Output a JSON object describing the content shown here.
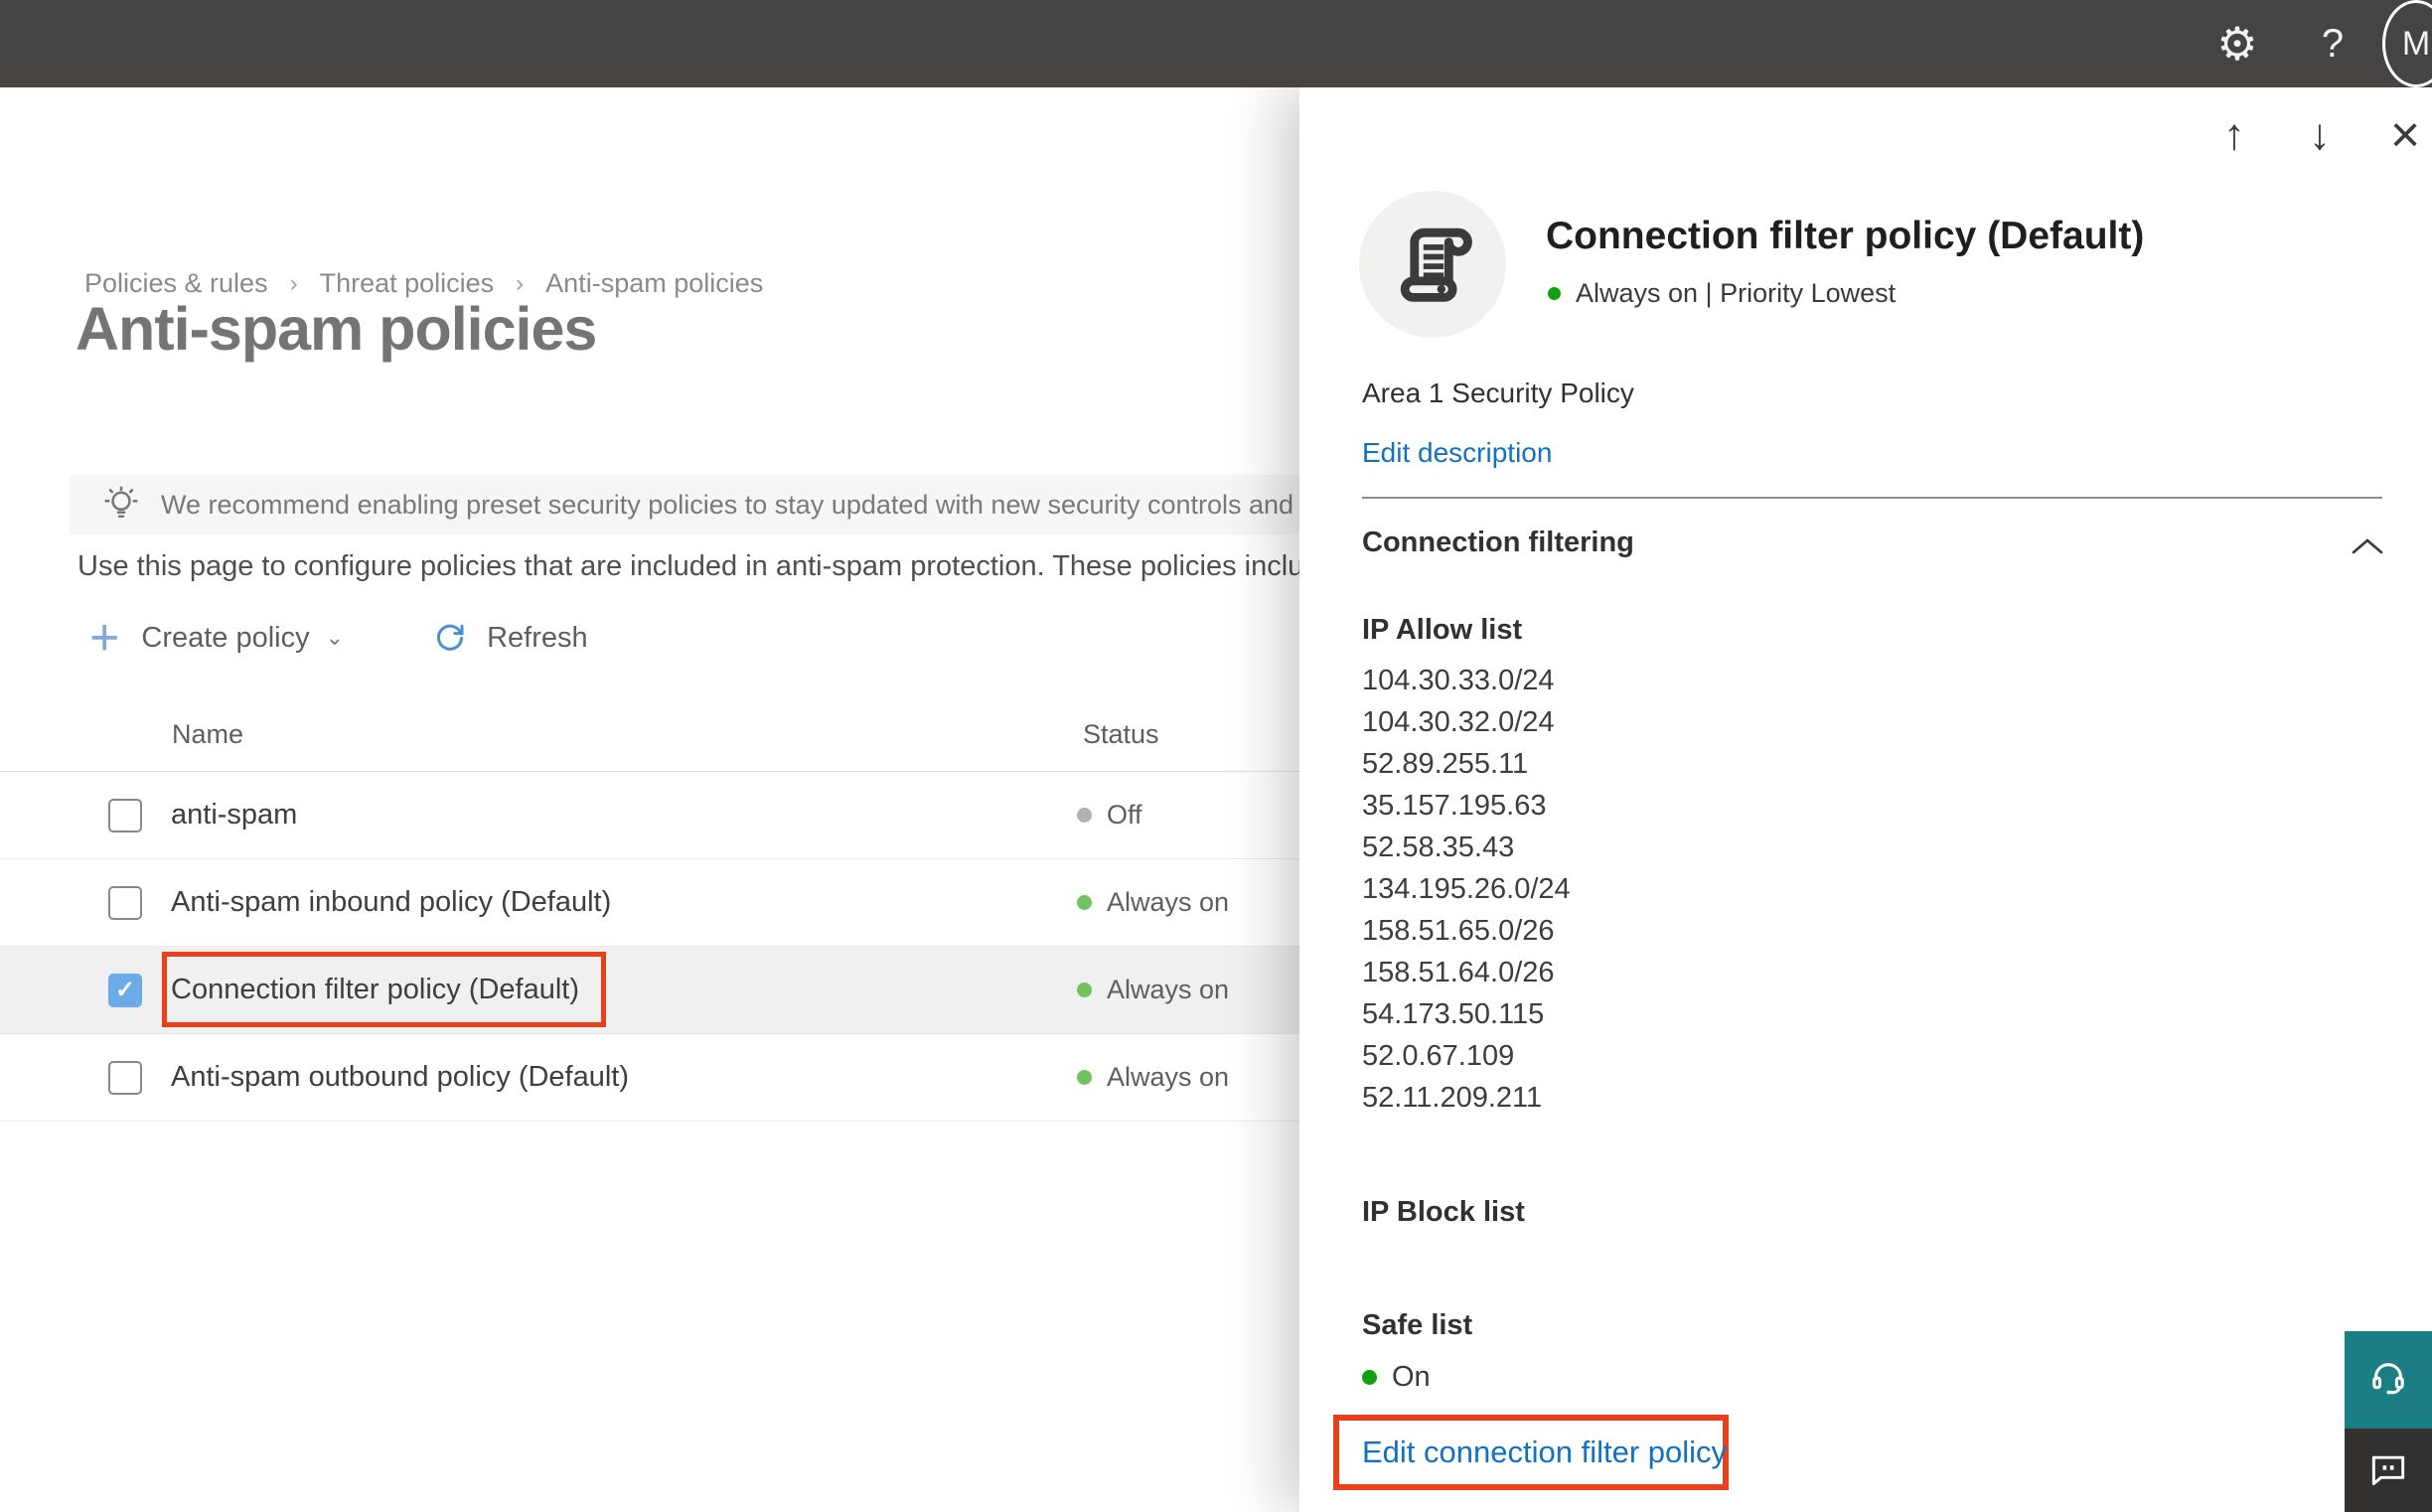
{
  "topbar": {
    "help_glyph": "?",
    "avatar_initial": "M"
  },
  "breadcrumb": [
    "Policies & rules",
    "Threat policies",
    "Anti-spam policies"
  ],
  "page": {
    "title": "Anti-spam policies",
    "banner_text": "We recommend enabling preset security policies to stay updated with new security controls and our recommendations",
    "intro_text": "Use this page to configure policies that are included in anti-spam protection. These policies include"
  },
  "toolbar": {
    "create_policy_label": "Create policy",
    "refresh_label": "Refresh"
  },
  "table": {
    "columns": [
      "Name",
      "Status"
    ],
    "rows": [
      {
        "name": "anti-spam",
        "status": "Off",
        "dot_color": "#b4b2b0",
        "checked": false,
        "selected": false,
        "annotated": false
      },
      {
        "name": "Anti-spam inbound policy (Default)",
        "status": "Always on",
        "dot_color": "#72c25e",
        "checked": false,
        "selected": false,
        "annotated": false
      },
      {
        "name": "Connection filter policy (Default)",
        "status": "Always on",
        "dot_color": "#72c25e",
        "checked": true,
        "selected": true,
        "annotated": true
      },
      {
        "name": "Anti-spam outbound policy (Default)",
        "status": "Always on",
        "dot_color": "#72c25e",
        "checked": false,
        "selected": false,
        "annotated": false
      }
    ]
  },
  "panel": {
    "title": "Connection filter policy (Default)",
    "status_text": "Always on | Priority Lowest",
    "description": "Area 1 Security Policy",
    "edit_description_label": "Edit description",
    "section_title": "Connection filtering",
    "ip_allow_title": "IP Allow list",
    "ip_allow_items": [
      "104.30.33.0/24",
      "104.30.32.0/24",
      "52.89.255.11",
      "35.157.195.63",
      "52.58.35.43",
      "134.195.26.0/24",
      "158.51.65.0/26",
      "158.51.64.0/26",
      "54.173.50.115",
      "52.0.67.109",
      "52.11.209.211"
    ],
    "ip_block_title": "IP Block list",
    "safe_list_title": "Safe list",
    "safe_list_status": "On",
    "edit_link_label": "Edit connection filter policy"
  },
  "colors": {
    "annotation_red": "#e8401c",
    "link_blue": "#1271c3",
    "panel_status_green": "#10a010",
    "table_status_green": "#72c25e",
    "support_teal": "#1b7e85",
    "topbar_gray": "#454442"
  }
}
